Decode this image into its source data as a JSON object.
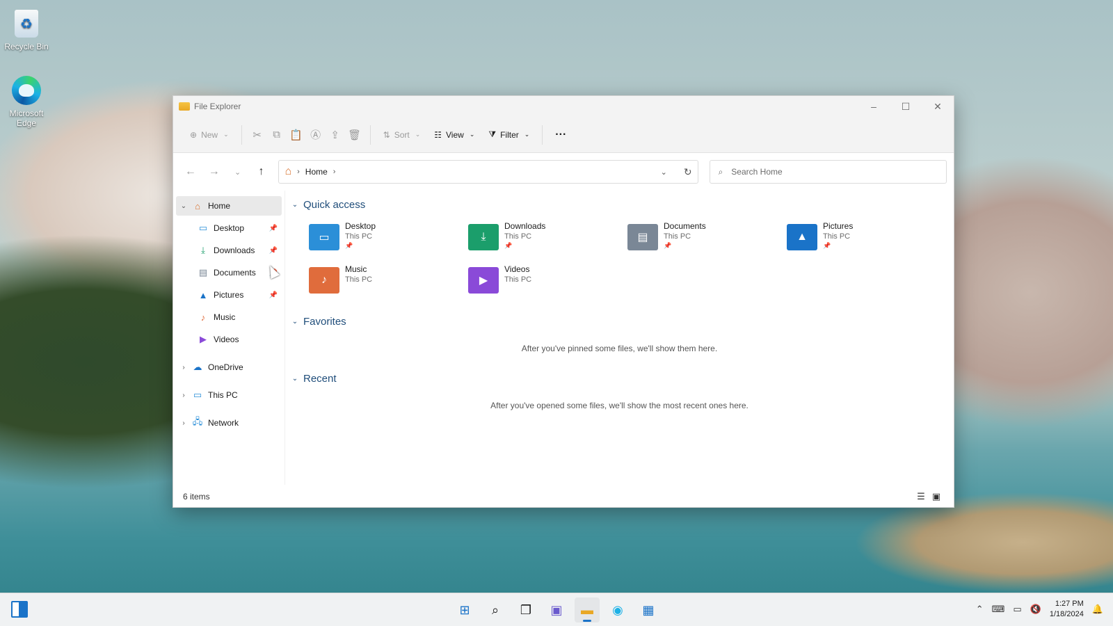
{
  "desktop": {
    "icons": [
      {
        "label": "Recycle Bin",
        "icon": "recycle-bin-icon"
      },
      {
        "label": "Microsoft Edge",
        "icon": "edge-icon"
      }
    ]
  },
  "window": {
    "title": "File Explorer",
    "controls": {
      "minimize": "–",
      "maximize": "☐",
      "close": "✕"
    }
  },
  "toolbar": {
    "new_label": "New",
    "sort_label": "Sort",
    "view_label": "View",
    "filter_label": "Filter",
    "more_label": "···"
  },
  "navbar": {
    "breadcrumb": [
      "Home"
    ],
    "search_placeholder": "Search Home"
  },
  "sidebar": {
    "home": "Home",
    "items": [
      {
        "label": "Desktop",
        "pinned": true,
        "icon": "desktop-icon",
        "color": "#2b8fd8"
      },
      {
        "label": "Downloads",
        "pinned": true,
        "icon": "download-icon",
        "color": "#1b9e6b"
      },
      {
        "label": "Documents",
        "pinned": true,
        "icon": "document-icon",
        "color": "#7a8796"
      },
      {
        "label": "Pictures",
        "pinned": true,
        "icon": "picture-icon",
        "color": "#1a73c8"
      },
      {
        "label": "Music",
        "pinned": false,
        "icon": "music-icon",
        "color": "#e06c3c"
      },
      {
        "label": "Videos",
        "pinned": false,
        "icon": "video-icon",
        "color": "#8a4ad8"
      }
    ],
    "roots": [
      {
        "label": "OneDrive",
        "icon": "onedrive-icon"
      },
      {
        "label": "This PC",
        "icon": "pc-icon"
      },
      {
        "label": "Network",
        "icon": "network-icon"
      }
    ]
  },
  "content": {
    "quick_access_title": "Quick access",
    "quick_access": [
      {
        "name": "Desktop",
        "location": "This PC",
        "pinned": true,
        "color": "#2b8fd8"
      },
      {
        "name": "Downloads",
        "location": "This PC",
        "pinned": true,
        "color": "#1b9e6b"
      },
      {
        "name": "Documents",
        "location": "This PC",
        "pinned": true,
        "color": "#7a8796"
      },
      {
        "name": "Pictures",
        "location": "This PC",
        "pinned": true,
        "color": "#1a73c8"
      },
      {
        "name": "Music",
        "location": "This PC",
        "pinned": false,
        "color": "#e06c3c"
      },
      {
        "name": "Videos",
        "location": "This PC",
        "pinned": false,
        "color": "#8a4ad8"
      }
    ],
    "favorites_title": "Favorites",
    "favorites_empty": "After you've pinned some files, we'll show them here.",
    "recent_title": "Recent",
    "recent_empty": "After you've opened some files, we'll show the most recent ones here."
  },
  "statusbar": {
    "item_count": "6 items"
  },
  "taskbar": {
    "apps": [
      "start-icon",
      "search-icon",
      "task-view-icon",
      "chat-icon",
      "file-explorer-icon",
      "edge-icon",
      "store-icon"
    ],
    "time": "1:27 PM",
    "date": "1/18/2024"
  }
}
